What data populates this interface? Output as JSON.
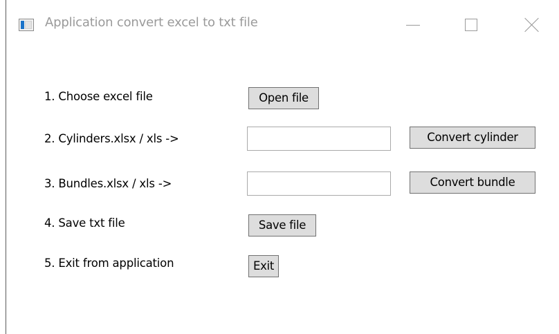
{
  "window": {
    "title": "Application convert excel to txt file",
    "icon": "app-window-icon",
    "controls": {
      "minimize_icon": "minimize-icon",
      "maximize_icon": "maximize-icon",
      "close_icon": "close-icon"
    }
  },
  "steps": {
    "choose": {
      "label": "1. Choose excel file",
      "button": "Open file"
    },
    "cylinders": {
      "label": "2. Cylinders.xlsx / xls ->",
      "field_value": "",
      "button": "Convert cylinder"
    },
    "bundles": {
      "label": "3. Bundles.xlsx / xls ->",
      "field_value": "",
      "button": "Convert bundle"
    },
    "save": {
      "label": "4. Save txt file",
      "button": "Save file"
    },
    "exit": {
      "label": "5. Exit from application",
      "button": "Exit"
    }
  },
  "colors": {
    "button_face": "#dddddd",
    "button_border": "#707070",
    "title_text": "#9a9a9a",
    "icon_accent": "#1a73c9"
  }
}
